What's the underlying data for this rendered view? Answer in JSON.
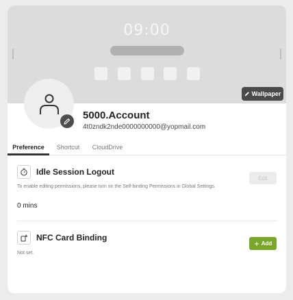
{
  "banner": {
    "clock": "09:00",
    "wallpaper_label": "Wallpaper"
  },
  "account": {
    "name": "5000.Account",
    "email": "4t0zndk2nde0000000000@yopmail.com"
  },
  "tabs": [
    {
      "label": "Preference"
    },
    {
      "label": "Shortcut"
    },
    {
      "label": "CloudDrive"
    }
  ],
  "idle_session": {
    "title": "Idle Session Logout",
    "note": "To enable editing permissions, please turn on the Self-binding Permissions in Global Settings.",
    "value": "0 mins",
    "edit_label": "Edit"
  },
  "nfc": {
    "title": "NFC Card Binding",
    "note": "Not set.",
    "add_label": "Add"
  },
  "colors": {
    "accent": "#7aa62b",
    "dark_button": "#4a4a4a"
  },
  "icons": [
    "pencil-icon",
    "user-icon",
    "timer-icon",
    "nfc-card-icon",
    "plus-icon"
  ]
}
